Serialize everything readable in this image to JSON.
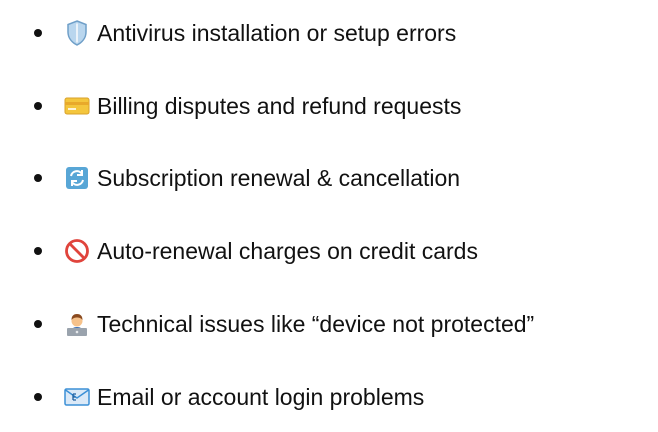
{
  "issues_list": {
    "items": [
      {
        "icon": "shield-icon",
        "label": "Antivirus installation or setup errors"
      },
      {
        "icon": "credit-card-icon",
        "label": "Billing disputes and refund requests"
      },
      {
        "icon": "refresh-arrows-icon",
        "label": "Subscription renewal & cancellation"
      },
      {
        "icon": "prohibited-icon",
        "label": "Auto-renewal charges on credit cards"
      },
      {
        "icon": "technologist-icon",
        "label": "Technical issues like “device not protected”"
      },
      {
        "icon": "incoming-envelope-icon",
        "label": "Email or account login problems"
      }
    ]
  },
  "colors": {
    "text": "#111111",
    "bullet": "#111111",
    "shield_fill": "#b9d6ee",
    "shield_stroke": "#6f9fc8",
    "card_fill": "#f4c63d",
    "card_stripe": "#e8a92b",
    "refresh_bg": "#58a6d6",
    "prohibited_red": "#e0443c",
    "envelope_blue": "#3b8fd6"
  }
}
